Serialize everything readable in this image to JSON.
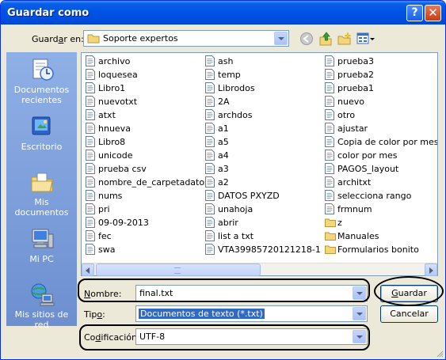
{
  "window": {
    "title": "Guardar como"
  },
  "titlebar_buttons": {
    "help": "?",
    "close": "✕"
  },
  "toolbar": {
    "save_in_label_prefix": "Guard",
    "save_in_label_accel": "a",
    "save_in_label_suffix": "r en:",
    "save_in_value": "Soporte expertos",
    "icons": [
      "back-icon",
      "up-folder-icon",
      "new-folder-icon",
      "view-menu-icon"
    ]
  },
  "places": [
    {
      "line1": "Documentos",
      "line2": "recientes",
      "icon": "recent-documents-icon"
    },
    {
      "line1": "Escritorio",
      "line2": "",
      "icon": "desktop-icon"
    },
    {
      "line1": "Mis documentos",
      "line2": "",
      "icon": "my-documents-icon"
    },
    {
      "line1": "Mi PC",
      "line2": "",
      "icon": "my-computer-icon"
    },
    {
      "line1": "Mis sitios de red",
      "line2": "",
      "icon": "network-places-icon"
    }
  ],
  "files": {
    "col1": [
      "archivo",
      "loquesea",
      "Libro1",
      "nuevotxt",
      "atxt",
      "hnueva",
      "Libro8",
      "unicode",
      "prueba csv",
      "nombre_de_carpetadatos",
      "nums",
      "pri",
      "09-09-2013",
      "fec",
      "swa"
    ],
    "col2": [
      "ash",
      "temp",
      "Librodos",
      "2A",
      "archdos",
      "a1",
      "a5",
      "a4",
      "a3",
      "a2",
      "DATOS PXYZD",
      "unahoja",
      "abrir",
      "list a txt",
      "VTA39985720121218-1"
    ],
    "col3": [
      {
        "name": "prueba3",
        "type": "file"
      },
      {
        "name": "prueba2",
        "type": "file"
      },
      {
        "name": "prueba1",
        "type": "file"
      },
      {
        "name": "nuevo",
        "type": "file"
      },
      {
        "name": "otro",
        "type": "file"
      },
      {
        "name": "ajustar",
        "type": "file"
      },
      {
        "name": "Copia de color por mes",
        "type": "file"
      },
      {
        "name": "color por mes",
        "type": "file"
      },
      {
        "name": "PAGOS_layout",
        "type": "file"
      },
      {
        "name": "architxt",
        "type": "file"
      },
      {
        "name": "selecciona rango",
        "type": "file"
      },
      {
        "name": "frmnum",
        "type": "file"
      },
      {
        "name": "z",
        "type": "folder"
      },
      {
        "name": "Manuales",
        "type": "folder"
      },
      {
        "name": "Formularios bonito",
        "type": "folder"
      }
    ]
  },
  "form": {
    "filename_label_accel": "N",
    "filename_label_rest": "ombre:",
    "filename_value": "final.txt",
    "type_label_prefix": "Tip",
    "type_label_accel": "o",
    "type_label_suffix": ":",
    "type_value": "Documentos de texto (*.txt)",
    "encoding_label_prefix": "Co",
    "encoding_label_accel": "d",
    "encoding_label_suffix": "ificación:",
    "encoding_value": "UTF-8"
  },
  "buttons": {
    "save_accel": "G",
    "save_rest": "uardar",
    "cancel": "Cancelar"
  },
  "colors": {
    "titlebar": "#0055e5",
    "dialog_bg": "#ece9d8",
    "places_bar": "#7e9ed8",
    "selection": "#316ac5"
  }
}
